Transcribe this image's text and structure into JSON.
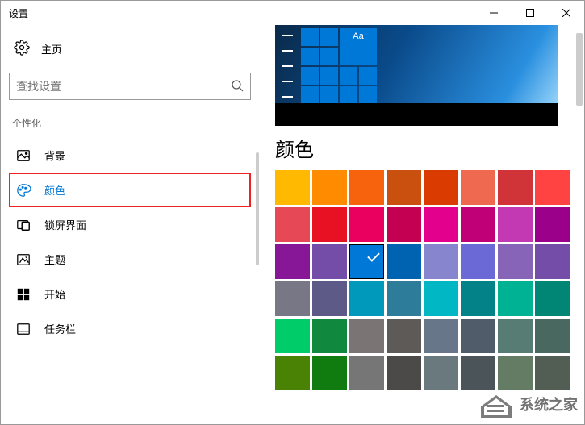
{
  "window": {
    "title": "设置"
  },
  "home": {
    "label": "主页"
  },
  "search": {
    "placeholder": "查找设置"
  },
  "section": {
    "label": "个性化"
  },
  "nav": {
    "items": [
      {
        "key": "background",
        "label": "背景"
      },
      {
        "key": "color",
        "label": "颜色"
      },
      {
        "key": "lockscreen",
        "label": "锁屏界面"
      },
      {
        "key": "themes",
        "label": "主题"
      },
      {
        "key": "start",
        "label": "开始"
      },
      {
        "key": "taskbar",
        "label": "任务栏"
      }
    ],
    "selected": "color"
  },
  "preview": {
    "tile_text": "Aa"
  },
  "panel": {
    "title": "颜色"
  },
  "colors": {
    "selected_index": 18,
    "swatches": [
      "#ffb900",
      "#ff8c00",
      "#f7630c",
      "#ca5010",
      "#da3b01",
      "#ef6950",
      "#d13438",
      "#ff4343",
      "#e74856",
      "#e81123",
      "#ea005e",
      "#c30052",
      "#e3008c",
      "#bf0077",
      "#c239b3",
      "#9a0089",
      "#881798",
      "#744da9",
      "#0078d7",
      "#0063b1",
      "#8785cd",
      "#6b69d6",
      "#8764b8",
      "#744da9",
      "#777785",
      "#5d5a88",
      "#0099bc",
      "#2d7d9a",
      "#00b7c3",
      "#038387",
      "#00b294",
      "#018574",
      "#00cc6a",
      "#10893e",
      "#7a7574",
      "#5d5a58",
      "#68768a",
      "#515c6b",
      "#567c73",
      "#486860",
      "#498205",
      "#107c10",
      "#767676",
      "#4c4a48",
      "#69797e",
      "#4a5459",
      "#647c64",
      "#525e54"
    ]
  },
  "watermark": {
    "text": "系统之家"
  }
}
